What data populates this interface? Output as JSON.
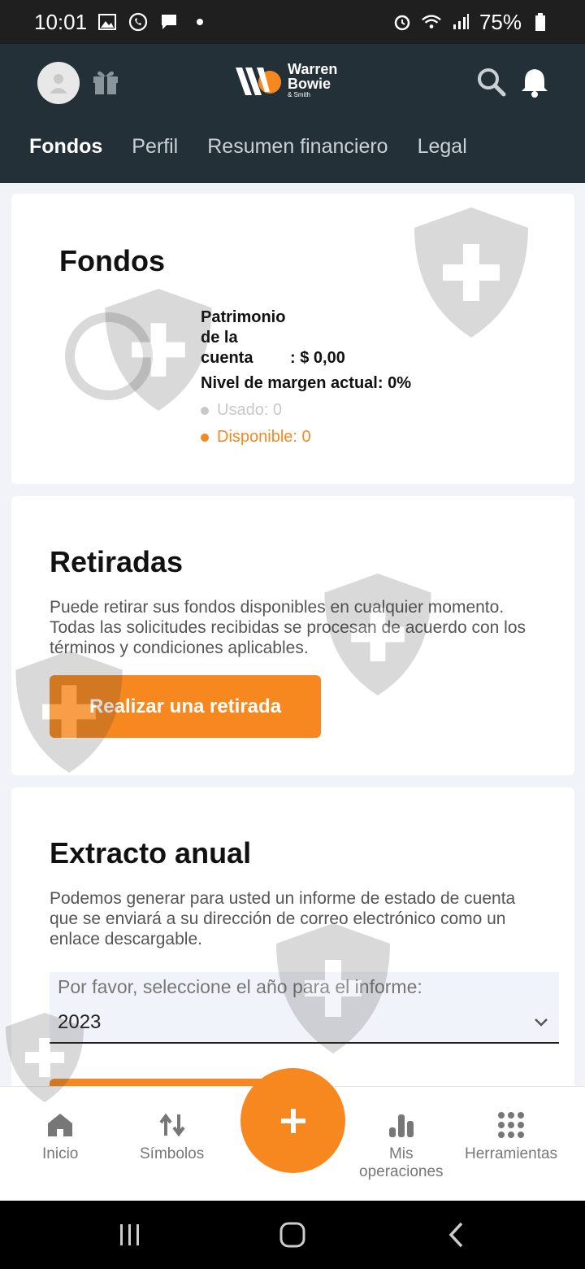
{
  "status_bar": {
    "time": "10:01",
    "battery": "75%"
  },
  "header": {
    "logo_line1": "Warren",
    "logo_line2": "Bowie",
    "logo_sub": "& Smith",
    "tabs": [
      {
        "label": "Fondos",
        "active": true
      },
      {
        "label": "Perfil",
        "active": false
      },
      {
        "label": "Resumen financiero",
        "active": false
      },
      {
        "label": "Legal",
        "active": false
      }
    ]
  },
  "funds": {
    "title": "Fondos",
    "equity_label_1": "Patrimonio",
    "equity_label_2": "de la",
    "equity_label_3": "cuenta",
    "equity_value": ": $ 0,00",
    "margin_text": "Nivel de margen actual: 0%",
    "used_text": "Usado: 0",
    "available_text": "Disponible: 0"
  },
  "withdrawals": {
    "title": "Retiradas",
    "description": "Puede retirar sus fondos disponibles en cualquier momento. Todas las solicitudes recibidas se procesan de acuerdo con los términos y condiciones aplicables.",
    "button_label": "Realizar una retirada"
  },
  "annual_statement": {
    "title": "Extracto anual",
    "description": "Podemos generar para usted un informe de estado de cuenta que se enviará a su dirección de correo electrónico como un enlace descargable.",
    "select_label": "Por favor, seleccione el año para el informe:",
    "select_value": "2023"
  },
  "bottom_nav": {
    "home": "Inicio",
    "symbols": "Símbolos",
    "operations_line1": "Mis",
    "operations_line2": "operaciones",
    "tools": "Herramientas"
  },
  "colors": {
    "accent": "#f7881f",
    "header_bg": "#243038",
    "page_bg": "#f1f3f8"
  }
}
